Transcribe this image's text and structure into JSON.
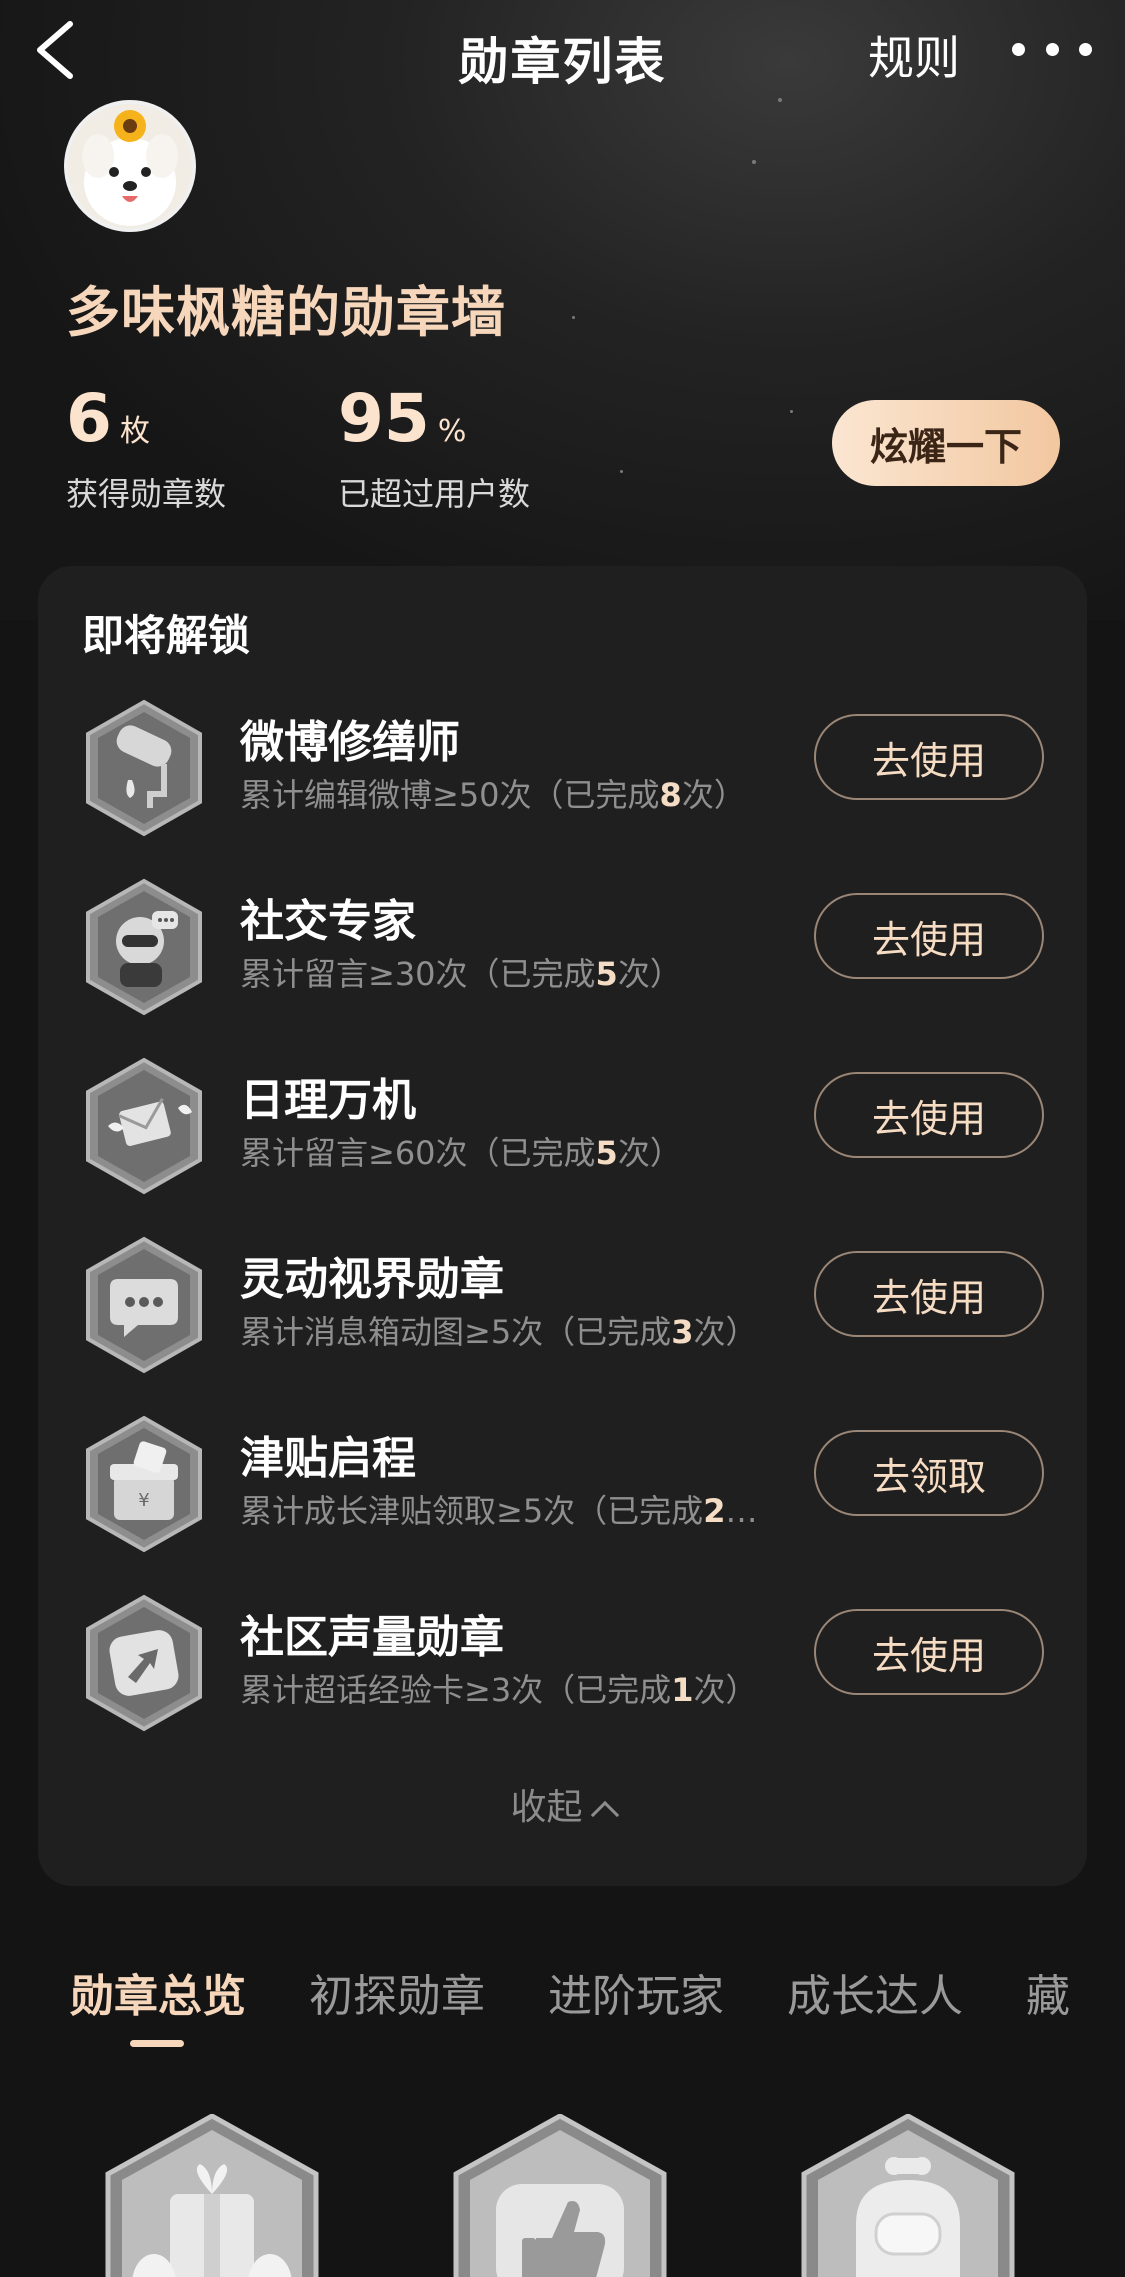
{
  "header": {
    "title": "勋章列表",
    "rules_label": "规则",
    "back_icon": "chevron-left-icon",
    "more_icon": "more-dots-icon"
  },
  "profile": {
    "avatar_icon": "pomeranian-avatar",
    "wall_title": "多味枫糖的勋章墙",
    "badges_count": "6",
    "badges_unit": "枚",
    "badges_label": "获得勋章数",
    "percentile": "95",
    "percentile_unit": "%",
    "percentile_label": "已超过用户数",
    "show_off_label": "炫耀一下"
  },
  "unlock": {
    "title": "即将解锁",
    "items": [
      {
        "name": "微博修缮师",
        "desc_prefix": "累计编辑微博≥50次（已完成",
        "done": "8",
        "desc_suffix": "次）",
        "action": "去使用",
        "icon": "paint-roller-icon"
      },
      {
        "name": "社交专家",
        "desc_prefix": "累计留言≥30次（已完成",
        "done": "5",
        "desc_suffix": "次）",
        "action": "去使用",
        "icon": "social-character-icon"
      },
      {
        "name": "日理万机",
        "desc_prefix": "累计留言≥60次（已完成",
        "done": "5",
        "desc_suffix": "次）",
        "action": "去使用",
        "icon": "winged-envelope-icon"
      },
      {
        "name": "灵动视界勋章",
        "desc_prefix": "累计消息箱动图≥5次（已完成",
        "done": "3",
        "desc_suffix": "次）",
        "action": "去使用",
        "icon": "chat-bubble-icon"
      },
      {
        "name": "津贴启程",
        "desc_prefix": "累计成长津贴领取≥5次（已完成",
        "done": "2",
        "desc_suffix": "…",
        "action": "去领取",
        "icon": "gift-box-icon"
      },
      {
        "name": "社区声量勋章",
        "desc_prefix": "累计超话经验卡≥3次（已完成",
        "done": "1",
        "desc_suffix": "次）",
        "action": "去使用",
        "icon": "share-arrow-icon"
      }
    ],
    "collapse_label": "收起",
    "collapse_icon": "chevron-up-icon"
  },
  "tabs": {
    "items": [
      "勋章总览",
      "初探勋章",
      "进阶玩家",
      "成长达人",
      "藏"
    ],
    "active_index": 0
  },
  "bottom_badges": [
    "gift-hands-badge-icon",
    "thumbs-up-badge-icon",
    "mascot-badge-icon"
  ],
  "colors": {
    "accent": "#f6d7bc",
    "background": "#141414",
    "card": "#1f1f1f",
    "button_gradient_start": "#fbe6d2",
    "button_gradient_end": "#f2c79f"
  }
}
